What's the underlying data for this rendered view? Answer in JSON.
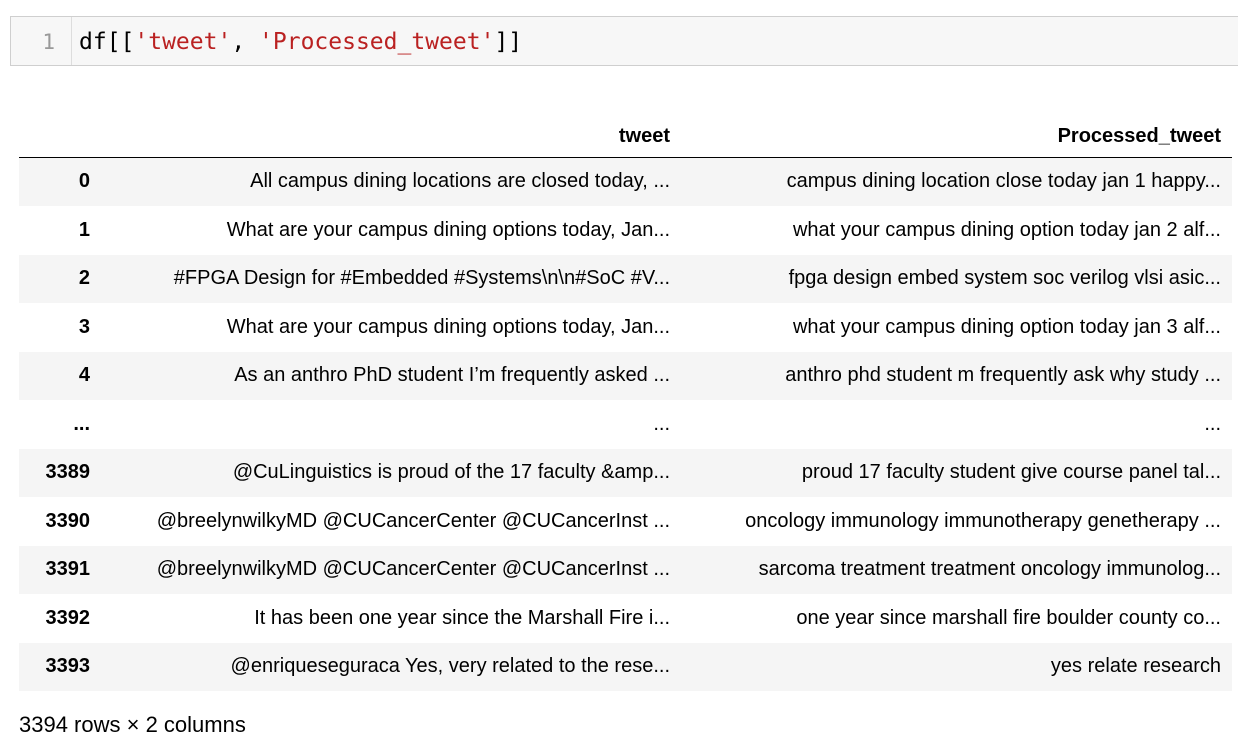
{
  "code_cell": {
    "line_number": "1",
    "code_prefix": "df[[",
    "string1": "'tweet'",
    "separator": ", ",
    "string2": "'Processed_tweet'",
    "code_suffix": "]]"
  },
  "table": {
    "columns": [
      "",
      "tweet",
      "Processed_tweet"
    ],
    "rows": [
      {
        "index": "0",
        "tweet": "All campus dining locations are closed today, ...",
        "processed": "campus dining location close today jan 1 happy..."
      },
      {
        "index": "1",
        "tweet": "What are your campus dining options today, Jan...",
        "processed": "what your campus dining option today jan 2 alf..."
      },
      {
        "index": "2",
        "tweet": "#FPGA Design for #Embedded #Systems\\n\\n#SoC #V...",
        "processed": "fpga design embed system soc verilog vlsi asic..."
      },
      {
        "index": "3",
        "tweet": "What are your campus dining options today, Jan...",
        "processed": "what your campus dining option today jan 3 alf..."
      },
      {
        "index": "4",
        "tweet": "As an anthro PhD student I’m frequently asked ...",
        "processed": "anthro phd student m frequently ask why study ..."
      },
      {
        "index": "...",
        "tweet": "...",
        "processed": "..."
      },
      {
        "index": "3389",
        "tweet": "@CuLinguistics is proud of the 17 faculty &amp...",
        "processed": "proud 17 faculty student give course panel tal..."
      },
      {
        "index": "3390",
        "tweet": "@breelynwilkyMD @CUCancerCenter @CUCancerInst ...",
        "processed": "oncology immunology immunotherapy genetherapy ..."
      },
      {
        "index": "3391",
        "tweet": "@breelynwilkyMD @CUCancerCenter @CUCancerInst ...",
        "processed": "sarcoma treatment treatment oncology immunolog..."
      },
      {
        "index": "3392",
        "tweet": "It has been one year since the Marshall Fire i...",
        "processed": "one year since marshall fire boulder county co..."
      },
      {
        "index": "3393",
        "tweet": "@enriqueseguraca Yes, very related to the rese...",
        "processed": "yes relate research"
      }
    ]
  },
  "shape_text": "3394 rows × 2 columns"
}
